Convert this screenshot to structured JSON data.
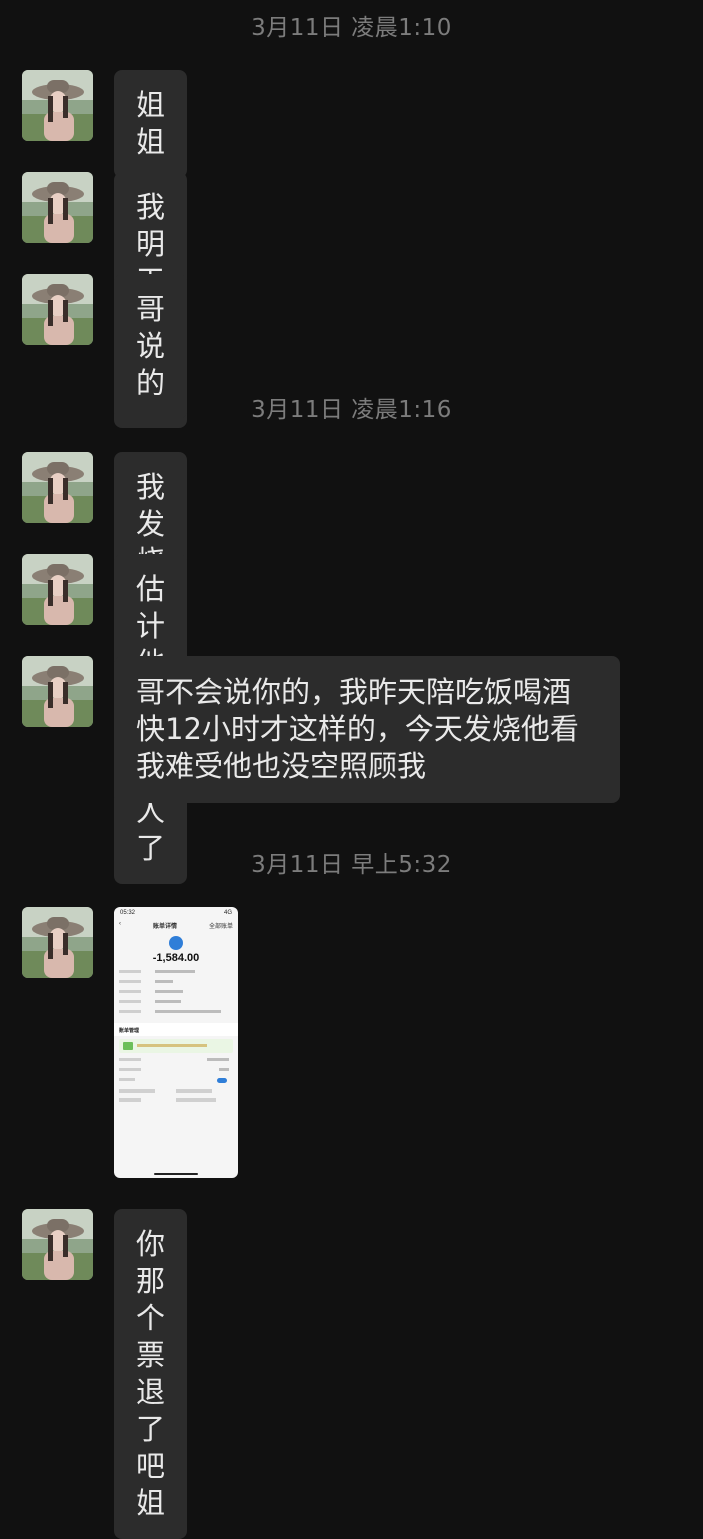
{
  "conversation": {
    "groups": [
      {
        "timestamp": "3月11日 凌晨1:10",
        "messages": [
          {
            "type": "text",
            "text": "姐姐"
          },
          {
            "type": "text",
            "text": "我明天一起回"
          },
          {
            "type": "text",
            "text": "哥说的"
          }
        ]
      },
      {
        "timestamp": "3月11日 凌晨1:16",
        "messages": [
          {
            "type": "text",
            "text": "我发烧挂点滴"
          },
          {
            "type": "text",
            "text": "估计他也想换人了"
          },
          {
            "type": "text",
            "text": "哥不会说你的，我昨天陪吃饭喝酒快12小时才这样的，今天发烧他看我难受他也没空照顾我"
          }
        ]
      },
      {
        "timestamp": "3月11日 早上5:32",
        "messages": [
          {
            "type": "image",
            "thumbnail": {
              "status_time": "05:32",
              "status_right": "4G",
              "nav_title": "账单详情",
              "nav_right": "全部账单",
              "amount": "-1,584.00",
              "section_title": "账单管理"
            }
          },
          {
            "type": "text",
            "text": "你那个票退了吧姐"
          }
        ]
      }
    ]
  },
  "colors": {
    "background": "#111111",
    "bubble": "#2c2c2c",
    "text": "#e9e9e9",
    "timestamp": "#7c7c7c"
  }
}
